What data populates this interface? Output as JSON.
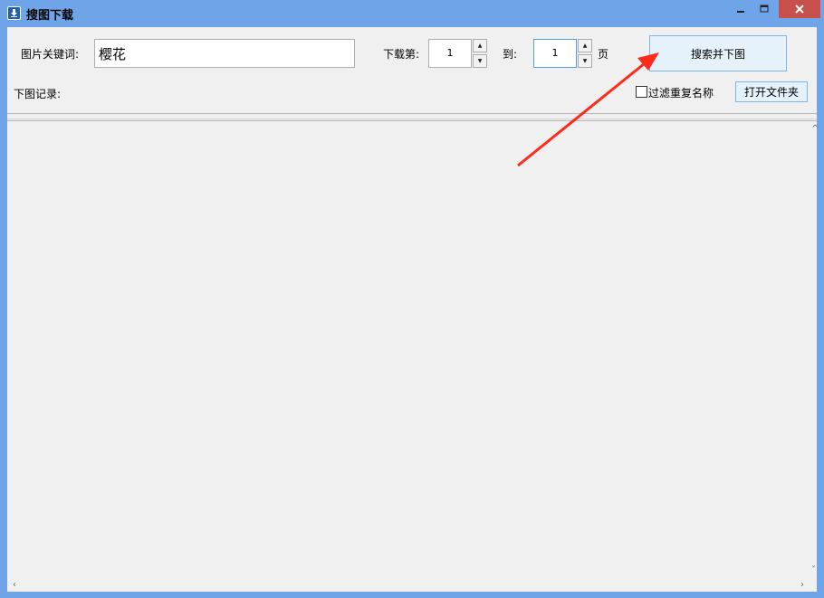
{
  "window": {
    "title": "搜图下载",
    "controls": {
      "minimize": "minimize",
      "maximize": "maximize",
      "close": "close"
    }
  },
  "form": {
    "keyword_label": "图片关键词:",
    "keyword_value": "樱花",
    "from_label": "下载第:",
    "from_value": "1",
    "to_label": "到:",
    "to_value": "1",
    "page_unit": "页",
    "search_button": "搜索并下图",
    "log_label": "下图记录:",
    "filter_checkbox_label": "过滤重复名称",
    "filter_checked": false,
    "open_folder_button": "打开文件夹"
  },
  "colors": {
    "frame": "#6fa5e8",
    "client_bg": "#f0f0f0",
    "close_button": "#c7504b",
    "annotation_arrow": "#ff2a1a"
  },
  "icons": {
    "app": "download-icon",
    "spin_up": "chevron-up-icon",
    "spin_down": "chevron-down-icon"
  }
}
